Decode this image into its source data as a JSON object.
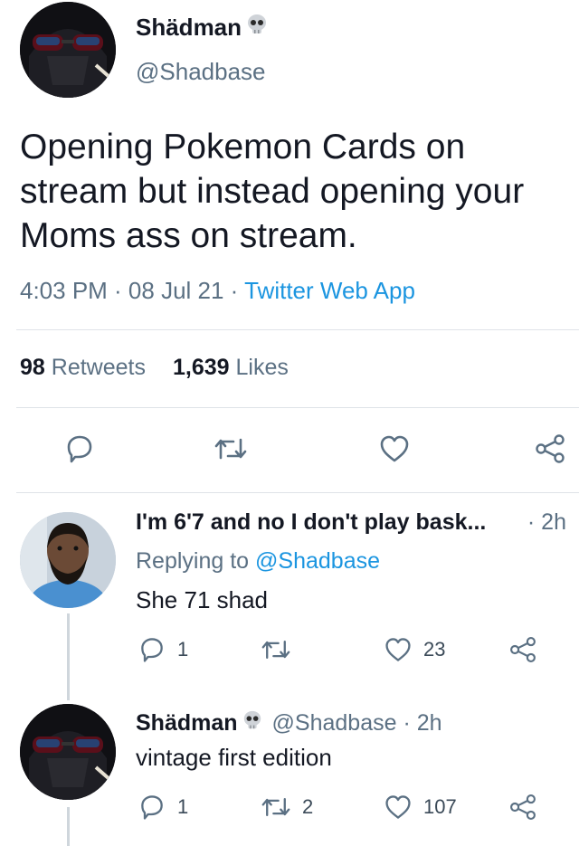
{
  "main_tweet": {
    "author_name": "Shädman",
    "author_handle": "@Shadbase",
    "text": "Opening Pokemon Cards on stream but instead opening your Moms ass on stream.",
    "time_date": "4:03 PM · 08 Jul 21 · ",
    "source": "Twitter Web App",
    "retweets_count": "98",
    "retweets_label": "Retweets",
    "likes_count": "1,639",
    "likes_label": "Likes"
  },
  "replies": [
    {
      "author_name": "I'm 6'7 and no I don't play bask...",
      "time": "· 2h",
      "replying_to_prefix": "Replying to ",
      "replying_to_handle": "@Shadbase",
      "text": "She 71 shad",
      "reply_count": "1",
      "retweet_count": "",
      "like_count": "23"
    },
    {
      "author_name": "Shädman",
      "author_handle_time": "@Shadbase · 2h",
      "text": "vintage first edition",
      "reply_count": "1",
      "retweet_count": "2",
      "like_count": "107"
    }
  ],
  "colors": {
    "link": "#1b95e0",
    "muted": "#5b7083",
    "text": "#141823"
  },
  "icons": [
    "skull-icon",
    "reply-icon",
    "retweet-icon",
    "like-icon",
    "share-icon"
  ]
}
